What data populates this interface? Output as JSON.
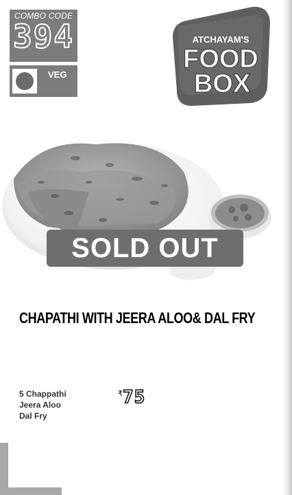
{
  "combo": {
    "label": "COMBO CODE",
    "code": "394"
  },
  "veg": {
    "label": "VEG"
  },
  "logo": {
    "line1": "ATCHAYAM'S",
    "line2": "FOOD",
    "line3": "BOX"
  },
  "product": {
    "badge": "SOLD OUT",
    "title": "CHAPATHI WITH JEERA ALOO& DAL FRY",
    "items": [
      "5 Chappathi",
      "Jeera Aloo",
      "Dal Fry"
    ],
    "currency": "₹",
    "price": "75"
  },
  "colors": {
    "box_gray": "#7c7c7c",
    "badge": "#6e6e6e"
  }
}
